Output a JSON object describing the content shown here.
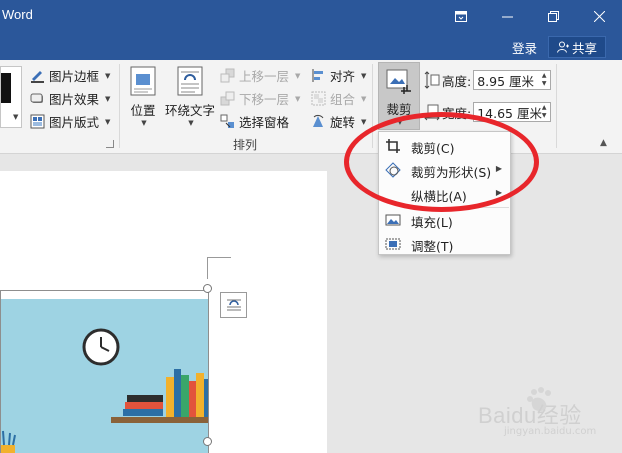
{
  "window": {
    "app_title": "Word",
    "login_label": "登录",
    "share_label": "共享"
  },
  "ribbon": {
    "picture_styles": {
      "border_label": "图片边框",
      "effects_label": "图片效果",
      "layout_label": "图片版式"
    },
    "arrange": {
      "position_label": "位置",
      "wrap_text_label": "环绕文字",
      "bring_forward_label": "上移一层",
      "send_backward_label": "下移一层",
      "selection_pane_label": "选择窗格",
      "align_label": "对齐",
      "group_label": "组合",
      "rotate_label": "旋转",
      "group_title": "排列"
    },
    "size": {
      "crop_label": "裁剪",
      "height_label": "高度:",
      "height_value": "8.95 厘米",
      "width_label": "宽度:",
      "width_value": "14.65 厘米"
    }
  },
  "crop_menu": {
    "items": [
      {
        "label": "裁剪(C)",
        "icon": "crop-icon",
        "submenu": false
      },
      {
        "label": "裁剪为形状(S)",
        "icon": "crop-shape-icon",
        "submenu": true
      },
      {
        "label": "纵横比(A)",
        "icon": "",
        "submenu": true
      },
      {
        "label": "填充(L)",
        "icon": "fill-icon",
        "submenu": false
      },
      {
        "label": "调整(T)",
        "icon": "fit-icon",
        "submenu": false
      }
    ]
  },
  "watermark": {
    "brand": "Baidu经验",
    "url": "jingyan.baidu.com"
  },
  "colors": {
    "title_bar": "#2b579a",
    "annotation": "#e8262b",
    "image_bg": "#9ed3e3"
  }
}
